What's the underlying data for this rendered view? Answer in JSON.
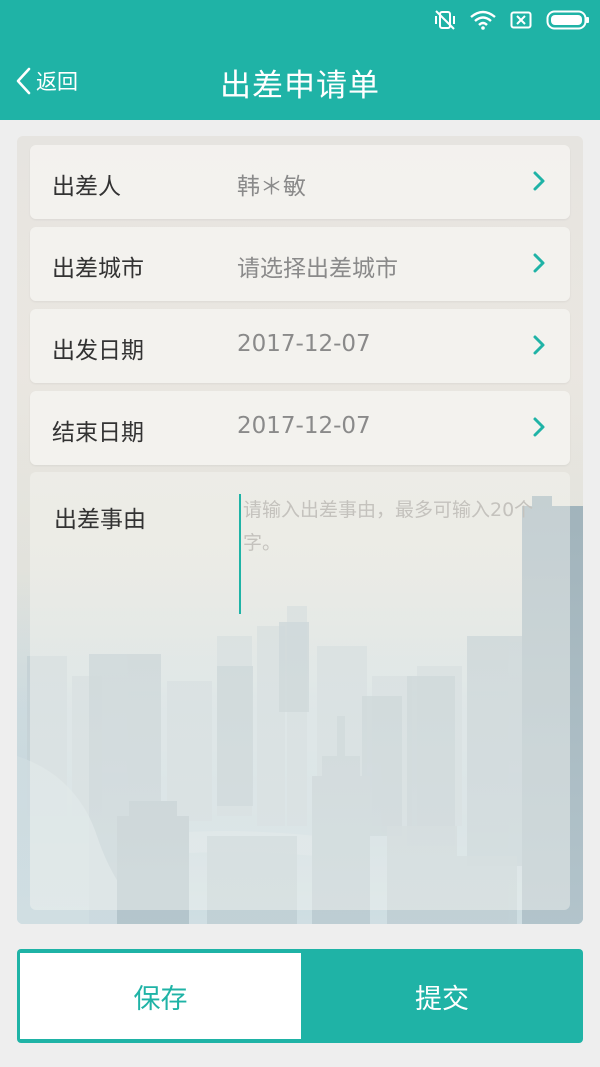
{
  "status_bar": {
    "icons": [
      "vibrate-off-icon",
      "wifi-icon",
      "no-sim-icon",
      "battery-icon"
    ]
  },
  "header": {
    "back_label": "返回",
    "title": "出差申请单"
  },
  "form": {
    "fields": [
      {
        "label": "出差人",
        "value": "韩＊敏"
      },
      {
        "label": "出差城市",
        "value": "请选择出差城市"
      },
      {
        "label": "出发日期",
        "value": "2017-12-07"
      },
      {
        "label": "结束日期",
        "value": "2017-12-07"
      }
    ],
    "reason": {
      "label": "出差事由",
      "placeholder": "请输入出差事由，最多可输入20个字。"
    }
  },
  "actions": {
    "save_label": "保存",
    "submit_label": "提交"
  },
  "colors": {
    "primary": "#1fb3a6",
    "background": "#eeeeee",
    "label_text": "#333333",
    "value_text": "#8a8a8a"
  }
}
